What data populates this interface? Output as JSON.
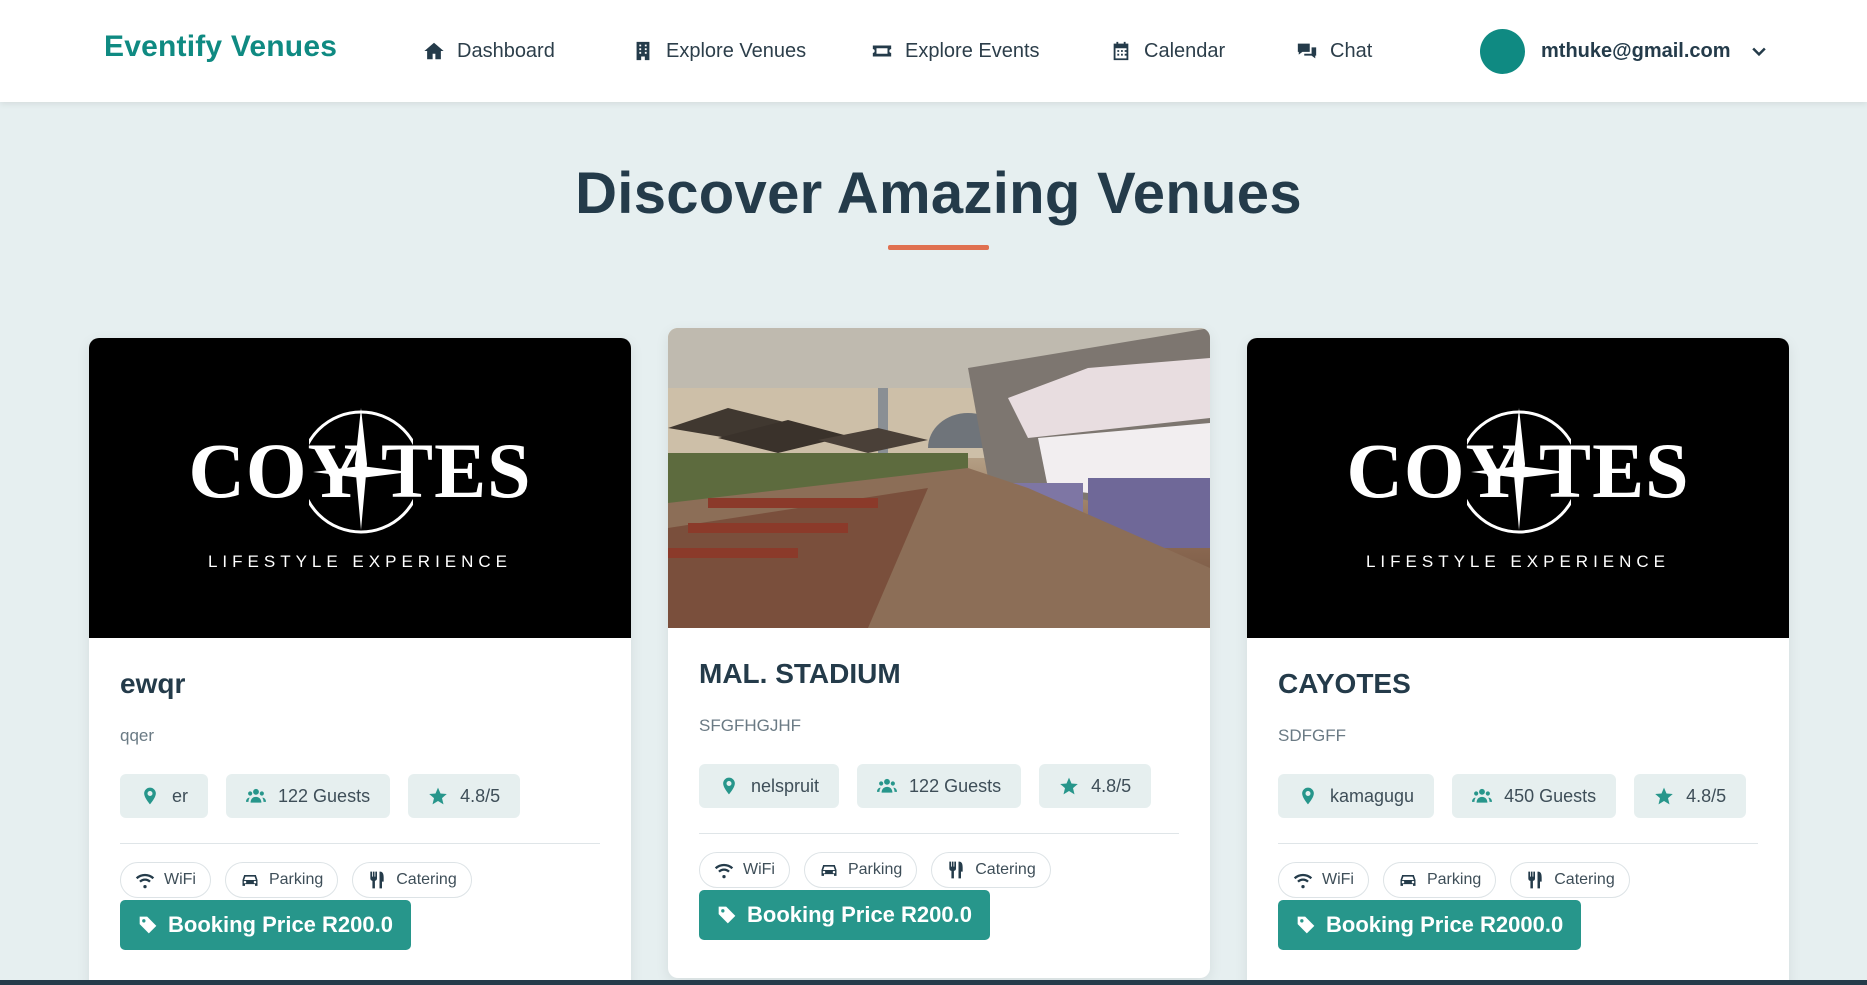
{
  "nav": {
    "brand": "Eventify Venues",
    "items": [
      {
        "label": "Dashboard",
        "icon": "home-icon"
      },
      {
        "label": "Explore Venues",
        "icon": "building-icon"
      },
      {
        "label": "Explore Events",
        "icon": "ticket-icon"
      },
      {
        "label": "Calendar",
        "icon": "calendar-icon"
      },
      {
        "label": "Chat",
        "icon": "chat-icon"
      }
    ],
    "user_email": "mthuke@gmail.com"
  },
  "page": {
    "title": "Discover Amazing Venues"
  },
  "colors": {
    "brand": "#0f8a82",
    "accent_underline": "#e07050",
    "button": "#27968b",
    "background": "#e6eff0"
  },
  "logo": {
    "main": "COY TES",
    "sub": "LIFESTYLE EXPERIENCE"
  },
  "venues": [
    {
      "name": "ewqr",
      "description": "qqer",
      "location": "er",
      "guests": "122 Guests",
      "rating": "4.8/5",
      "amenities": [
        "WiFi",
        "Parking",
        "Catering"
      ],
      "booking": "Booking Price R200.0",
      "image": "coyotes-logo"
    },
    {
      "name": "MAL. STADIUM",
      "description": "SFGFHGJHF",
      "location": "nelspruit",
      "guests": "122 Guests",
      "rating": "4.8/5",
      "amenities": [
        "WiFi",
        "Parking",
        "Catering"
      ],
      "booking": "Booking Price R200.0",
      "image": "outdoor-venue-photo"
    },
    {
      "name": "CAYOTES",
      "description": "SDFGFF",
      "location": "kamagugu",
      "guests": "450 Guests",
      "rating": "4.8/5",
      "amenities": [
        "WiFi",
        "Parking",
        "Catering"
      ],
      "booking": "Booking Price R2000.0",
      "image": "coyotes-logo"
    }
  ]
}
